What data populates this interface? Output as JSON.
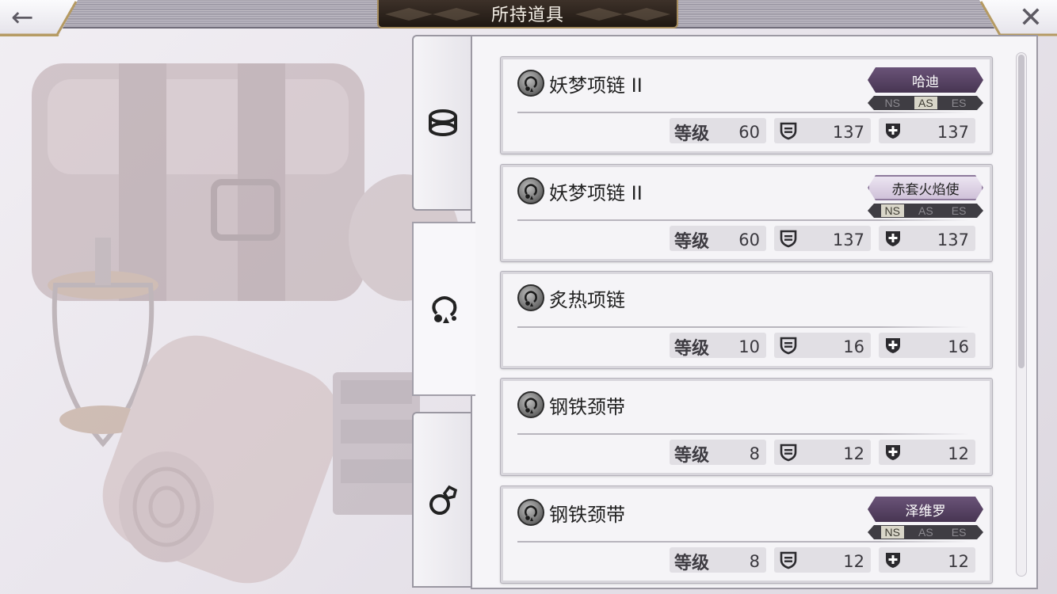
{
  "header": {
    "title": "所持道具",
    "back_icon": "←",
    "close_icon": "✕"
  },
  "tabs": [
    {
      "name": "bracelet",
      "icon": "bracelet-icon",
      "selected": false
    },
    {
      "name": "necklace",
      "icon": "necklace-icon",
      "selected": true
    },
    {
      "name": "ring",
      "icon": "ring-icon",
      "selected": false
    }
  ],
  "stat_labels": {
    "level": "等级"
  },
  "modes": [
    "NS",
    "AS",
    "ES"
  ],
  "items": [
    {
      "name": "妖梦项链 II",
      "owner": "哈迪",
      "owner_style": "dark",
      "active_mode": "AS",
      "level": "60",
      "defense": "137",
      "magic_defense": "137"
    },
    {
      "name": "妖梦项链 II",
      "owner": "赤套火焰使",
      "owner_style": "light",
      "active_mode": "NS",
      "level": "60",
      "defense": "137",
      "magic_defense": "137"
    },
    {
      "name": "炙热项链",
      "owner": "",
      "owner_style": "",
      "active_mode": "",
      "level": "10",
      "defense": "16",
      "magic_defense": "16"
    },
    {
      "name": "钢铁颈带",
      "owner": "",
      "owner_style": "",
      "active_mode": "",
      "level": "8",
      "defense": "12",
      "magic_defense": "12"
    },
    {
      "name": "钢铁颈带",
      "owner": "泽维罗",
      "owner_style": "dark",
      "active_mode": "NS",
      "level": "8",
      "defense": "12",
      "magic_defense": "12"
    }
  ],
  "colors": {
    "title_plate": "#2b221b",
    "gold_trim": "#a78d5e",
    "owner_dark": "#5a4466",
    "owner_light": "#ddd2e5"
  }
}
